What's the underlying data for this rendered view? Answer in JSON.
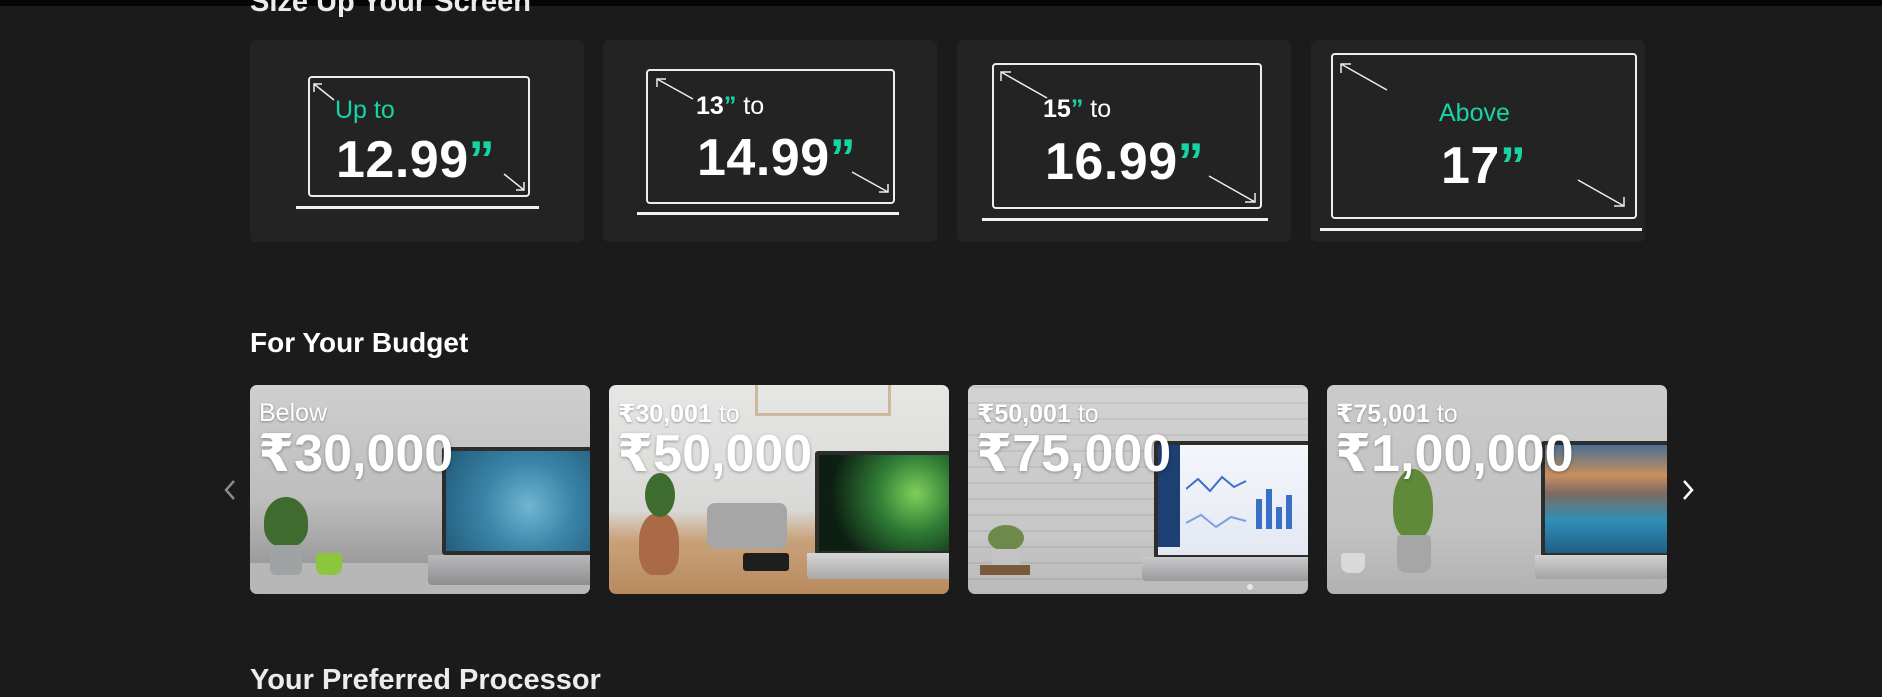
{
  "screen_section": {
    "title": "Size Up Your Screen",
    "cards": [
      {
        "prefix": "Up to",
        "size": "12.99",
        "quote": "”"
      },
      {
        "prefix_bold": "13",
        "prefix_quote": "”",
        "prefix_rest": " to",
        "size": "14.99",
        "quote": "”"
      },
      {
        "prefix_bold": "15",
        "prefix_quote": "”",
        "prefix_rest": " to",
        "size": "16.99",
        "quote": "”"
      },
      {
        "prefix": "Above",
        "size": "17",
        "quote": "”"
      }
    ]
  },
  "budget_section": {
    "title": "For Your Budget",
    "cards": [
      {
        "top": "Below",
        "amount": "₹30,000"
      },
      {
        "top_bold": "₹30,001",
        "top_rest": " to",
        "amount": "₹50,000"
      },
      {
        "top_bold": "₹50,001",
        "top_rest": " to",
        "amount": "₹75,000"
      },
      {
        "top_bold": "₹75,001",
        "top_rest": " to",
        "amount": "₹1,00,000"
      }
    ],
    "prev_icon": "chevron-left-icon",
    "next_icon": "chevron-right-icon"
  },
  "processor_section": {
    "title": "Your Preferred Processor"
  },
  "colors": {
    "background": "#1b1b1b",
    "card": "#232323",
    "accent": "#17d5a3"
  }
}
